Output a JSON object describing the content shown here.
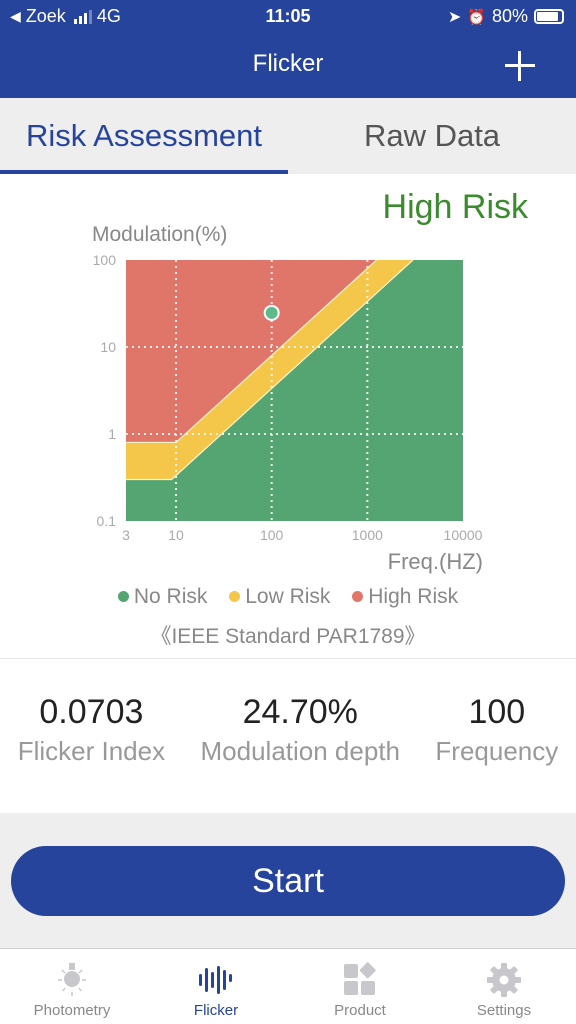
{
  "status_bar": {
    "back_label": "Zoek",
    "network": "4G",
    "time": "11:05",
    "battery": "80%",
    "battery_level_percent": 80
  },
  "nav": {
    "title": "Flicker",
    "add_icon": "plus-icon"
  },
  "tabs": [
    {
      "label": "Risk Assessment",
      "active": true
    },
    {
      "label": "Raw Data",
      "active": false
    }
  ],
  "risk_status": {
    "text": "High Risk",
    "color": "#3a8a2e"
  },
  "chart_data": {
    "type": "area",
    "title": "",
    "ylabel": "Modulation(%)",
    "xlabel": "Freq.(HZ)",
    "x_scale": "log",
    "y_scale": "log",
    "xlim": [
      3,
      10000
    ],
    "ylim": [
      0.1,
      100
    ],
    "x_ticks": [
      3,
      10,
      100,
      1000,
      10000
    ],
    "x_tick_labels": [
      "3",
      "10",
      "100",
      "1000",
      "10000"
    ],
    "y_ticks": [
      0.1,
      1,
      10,
      100
    ],
    "y_tick_labels": [
      "0.1",
      "1",
      "10",
      "100"
    ],
    "grid": true,
    "regions": [
      {
        "name": "No Risk",
        "color": "#55a572",
        "upper_boundary": [
          [
            3,
            0.3
          ],
          [
            9,
            0.3
          ],
          [
            3000,
            100
          ]
        ]
      },
      {
        "name": "Low Risk",
        "color": "#f4c74b",
        "upper_boundary": [
          [
            3,
            0.8
          ],
          [
            10,
            0.8
          ],
          [
            1250,
            100
          ]
        ]
      },
      {
        "name": "High Risk",
        "color": "#e0756a"
      }
    ],
    "points": [
      {
        "x": 100,
        "y": 24.7,
        "color": "#5dbb8a"
      }
    ],
    "legend": [
      {
        "label": "No Risk",
        "color": "#55a572"
      },
      {
        "label": "Low Risk",
        "color": "#f4c74b"
      },
      {
        "label": "High Risk",
        "color": "#e0756a"
      }
    ],
    "legend_position": "bottom"
  },
  "standard_label": "《IEEE Standard PAR1789》",
  "stats": [
    {
      "value": "0.0703",
      "label": "Flicker Index"
    },
    {
      "value": "24.70%",
      "label": "Modulation depth"
    },
    {
      "value": "100",
      "label": "Frequency"
    }
  ],
  "start_button": "Start",
  "tabbar": [
    {
      "label": "Photometry",
      "icon": "lightbulb-icon",
      "active": false
    },
    {
      "label": "Flicker",
      "icon": "waveform-icon",
      "active": true
    },
    {
      "label": "Product",
      "icon": "grid-icon",
      "active": false
    },
    {
      "label": "Settings",
      "icon": "gear-icon",
      "active": false
    }
  ]
}
